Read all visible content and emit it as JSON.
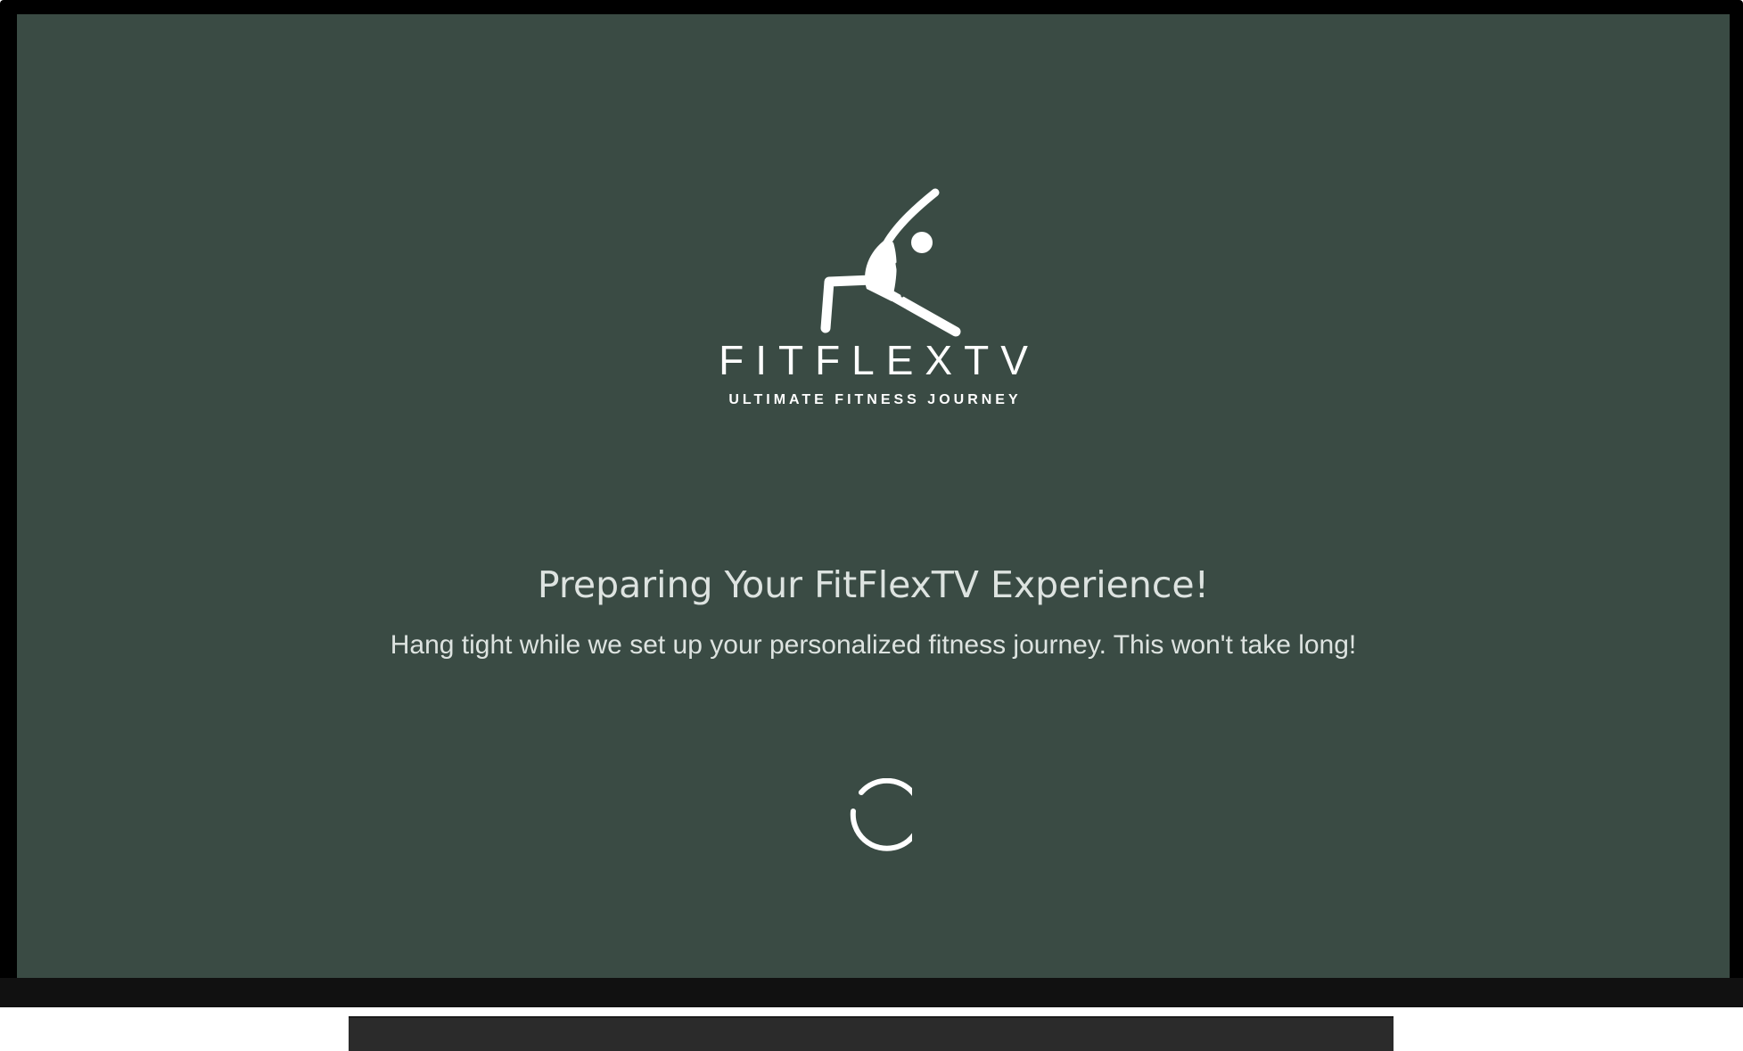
{
  "app": {
    "brand_name": "FITFLEXTV",
    "tagline": "ULTIMATE FITNESS JOURNEY",
    "logo_icon": "yoga-pose-icon"
  },
  "loading": {
    "title": "Preparing Your FitFlexTV Experience!",
    "message": "Hang tight while we set up your personalized fitness journey. This won't take long!",
    "indicator": "spinner-icon"
  },
  "colors": {
    "screen_background": "#3a4b44",
    "text": "#ffffff",
    "text_muted": "#dde3e0",
    "bezel": "#000000",
    "stand": "#2b2b2b"
  }
}
